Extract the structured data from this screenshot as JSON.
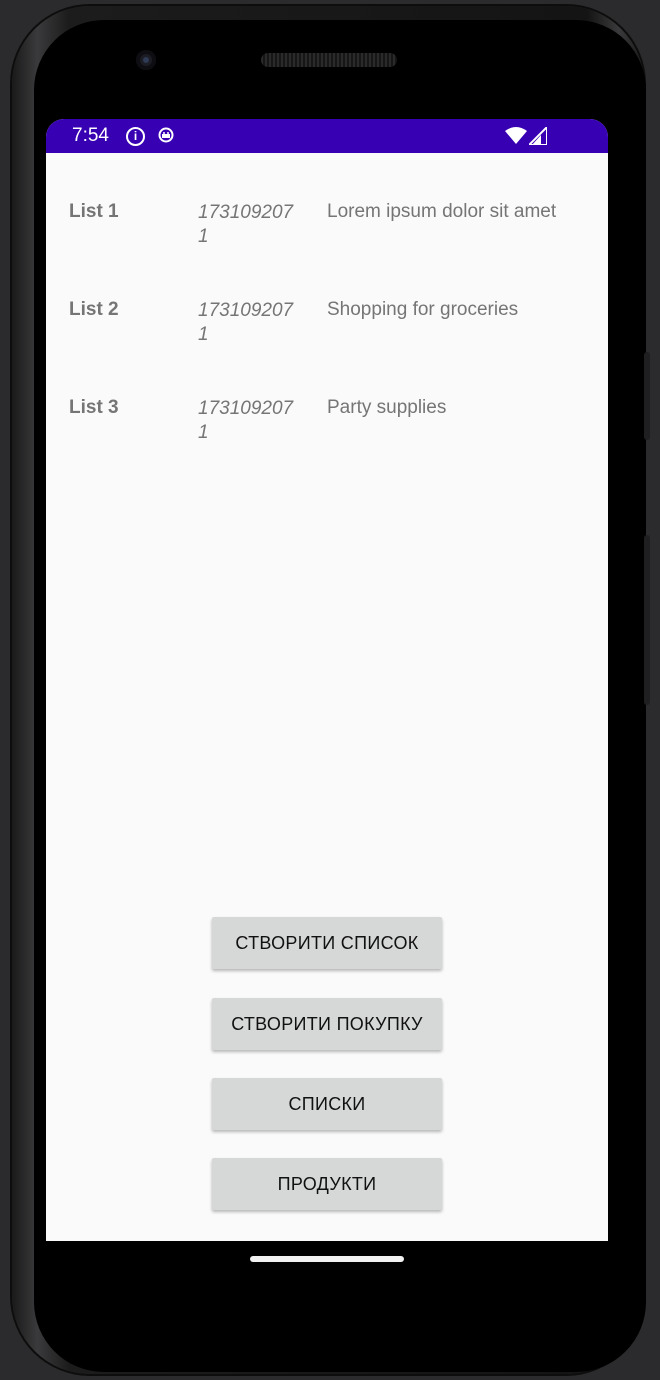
{
  "status_bar": {
    "time": "7:54",
    "info_icon": "i",
    "icons": [
      "info-icon",
      "android-debug-icon",
      "wifi-icon",
      "cell-signal-icon"
    ],
    "color": "#3700b3"
  },
  "lists": [
    {
      "name": "List 1",
      "date": "1731092071",
      "description": "Lorem ipsum dolor sit amet"
    },
    {
      "name": "List 2",
      "date": "1731092071",
      "description": "Shopping for groceries"
    },
    {
      "name": "List 3",
      "date": "1731092071",
      "description": "Party supplies"
    }
  ],
  "buttons": {
    "create_list": "СТВОРИТИ СПИСОК",
    "create_purchase": "СТВОРИТИ ПОКУПКУ",
    "lists": "СПИСКИ",
    "products": "ПРОДУКТИ"
  }
}
